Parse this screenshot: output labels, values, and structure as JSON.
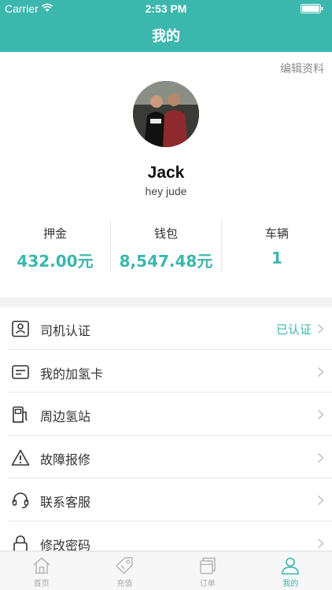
{
  "status_bar": {
    "carrier": "Carrier",
    "time": "2:53 PM"
  },
  "nav": {
    "title": "我的"
  },
  "profile": {
    "edit_label": "编辑资料",
    "name": "Jack",
    "bio": "hey jude",
    "stats": [
      {
        "label": "押金",
        "value": "432.00元"
      },
      {
        "label": "钱包",
        "value": "8,547.48元"
      },
      {
        "label": "车辆",
        "value": "1"
      }
    ]
  },
  "menu": [
    {
      "label": "司机认证",
      "status": "已认证",
      "icon": "driver-license-icon"
    },
    {
      "label": "我的加氢卡",
      "status": "",
      "icon": "card-icon"
    },
    {
      "label": "周边氢站",
      "status": "",
      "icon": "fuel-station-icon"
    },
    {
      "label": "故障报修",
      "status": "",
      "icon": "warning-icon"
    },
    {
      "label": "联系客服",
      "status": "",
      "icon": "headset-icon"
    },
    {
      "label": "修改密码",
      "status": "",
      "icon": "lock-icon"
    }
  ],
  "tabbar": [
    {
      "label": "首页",
      "icon": "home-icon",
      "active": false
    },
    {
      "label": "充值",
      "icon": "tag-icon",
      "active": false
    },
    {
      "label": "订单",
      "icon": "orders-icon",
      "active": false
    },
    {
      "label": "我的",
      "icon": "person-icon",
      "active": true
    }
  ],
  "colors": {
    "accent": "#3bb7ae",
    "background": "#f2f2f2"
  }
}
